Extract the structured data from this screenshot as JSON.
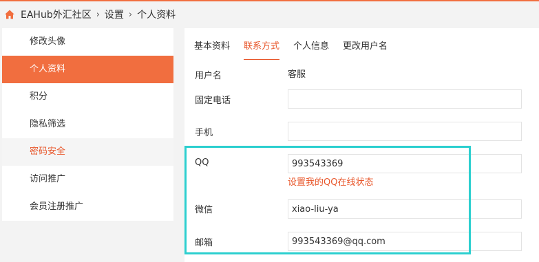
{
  "breadcrumb": {
    "home_icon": "home-icon",
    "items": [
      "EAHub外汇社区",
      "设置",
      "个人资料"
    ],
    "separator": "›"
  },
  "sidebar": {
    "items": [
      {
        "label": "修改头像"
      },
      {
        "label": "个人资料",
        "state": "active"
      },
      {
        "label": "积分"
      },
      {
        "label": "隐私筛选"
      },
      {
        "label": "密码安全",
        "state": "hover"
      },
      {
        "label": "访问推广"
      },
      {
        "label": "会员注册推广"
      }
    ]
  },
  "tabs": [
    {
      "label": "基本资料"
    },
    {
      "label": "联系方式",
      "active": true
    },
    {
      "label": "个人信息"
    },
    {
      "label": "更改用户名"
    }
  ],
  "form": {
    "username": {
      "label": "用户名",
      "value": "客服"
    },
    "phone": {
      "label": "固定电话",
      "value": ""
    },
    "mobile": {
      "label": "手机",
      "value": ""
    },
    "qq": {
      "label": "QQ",
      "value": "993543369",
      "link": "设置我的QQ在线状态"
    },
    "wechat": {
      "label": "微信",
      "value": "xiao-liu-ya"
    },
    "email": {
      "label": "邮箱",
      "value": "993543369@qq.com"
    }
  },
  "colors": {
    "accent": "#f16e3f",
    "link": "#e8562a",
    "highlight": "#2ccfcf"
  }
}
